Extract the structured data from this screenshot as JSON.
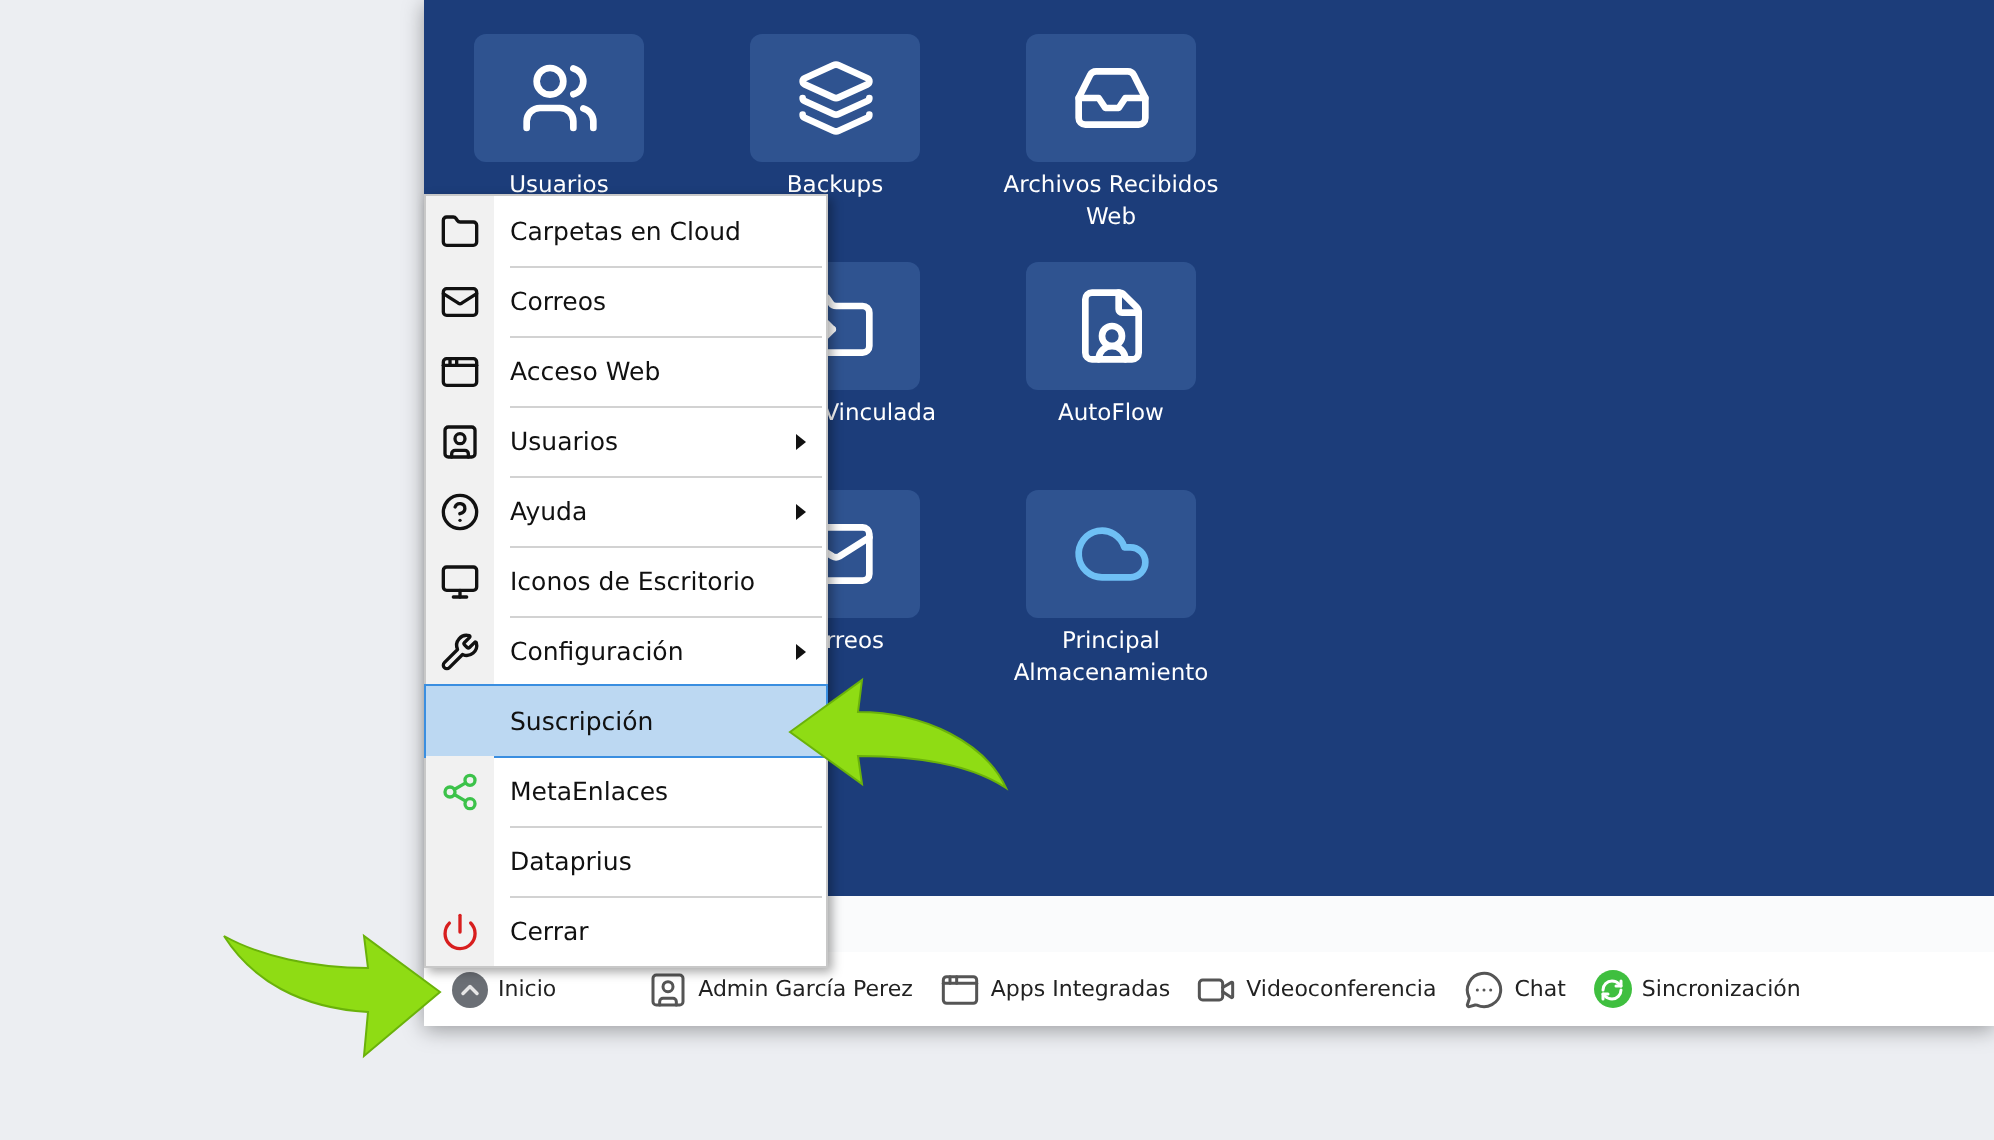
{
  "desktop": {
    "tiles": [
      {
        "label": "Usuarios"
      },
      {
        "label": "Backups"
      },
      {
        "label": "Archivos Recibidos Web"
      },
      {
        "label": "Vinculada"
      },
      {
        "label": "AutoFlow"
      },
      {
        "label": "rreos"
      },
      {
        "label": "Principal Almacenamiento"
      }
    ]
  },
  "start_menu": {
    "items": [
      {
        "label": "Carpetas en Cloud",
        "submenu": false,
        "selected": false
      },
      {
        "label": "Correos",
        "submenu": false,
        "selected": false
      },
      {
        "label": "Acceso Web",
        "submenu": false,
        "selected": false
      },
      {
        "label": "Usuarios",
        "submenu": true,
        "selected": false
      },
      {
        "label": "Ayuda",
        "submenu": true,
        "selected": false
      },
      {
        "label": "Iconos de Escritorio",
        "submenu": false,
        "selected": false
      },
      {
        "label": "Configuración",
        "submenu": true,
        "selected": false
      },
      {
        "label": "Suscripción",
        "submenu": false,
        "selected": true
      },
      {
        "label": "MetaEnlaces",
        "submenu": false,
        "selected": false
      },
      {
        "label": "Dataprius",
        "submenu": false,
        "selected": false
      },
      {
        "label": "Cerrar",
        "submenu": false,
        "selected": false
      }
    ]
  },
  "taskbar": {
    "items": [
      {
        "label": "Inicio"
      },
      {
        "label": "Admin García Perez"
      },
      {
        "label": "Apps Integradas"
      },
      {
        "label": "Videoconferencia"
      },
      {
        "label": "Chat"
      },
      {
        "label": "Sincronización"
      }
    ]
  }
}
